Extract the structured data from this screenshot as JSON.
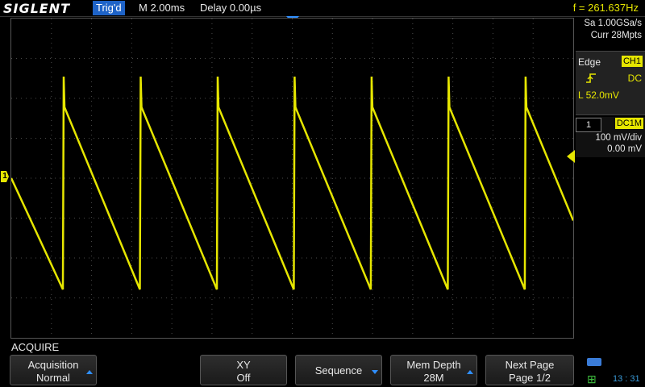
{
  "header": {
    "brand": "SIGLENT",
    "trigger_status": "Trig'd",
    "timebase": "M 2.00ms",
    "delay": "Delay 0.00µs",
    "frequency": "f = 261.637Hz"
  },
  "acquisition_info": {
    "sample_rate": "Sa 1.00GSa/s",
    "memory": "Curr 28Mpts"
  },
  "trigger_panel": {
    "type": "Edge",
    "source": "CH1",
    "slope_icon": "rising-edge-icon",
    "coupling": "DC",
    "level": "L  52.0mV"
  },
  "channel_panel": {
    "channel": "1",
    "coupling": "DC1M",
    "volts_per_div": "100 mV/div",
    "offset": "0.00 mV"
  },
  "channel_marker": "1",
  "waveform": {
    "type": "sawtooth",
    "color": "#e6e600",
    "periods_visible": 7.3
  },
  "menu": {
    "title": "ACQUIRE",
    "softkeys": [
      {
        "line1": "Acquisition",
        "line2": "Normal"
      },
      {
        "line1": "XY",
        "line2": "Off"
      },
      {
        "line1": "Sequence",
        "line2": ""
      },
      {
        "line1": "Mem Depth",
        "line2": "28M"
      },
      {
        "line1": "Next Page",
        "line2": "Page 1/2"
      }
    ]
  },
  "status": {
    "time": "13 : 31"
  },
  "colors": {
    "trace": "#e6e600",
    "accent": "#1e63c7",
    "grid": "#4a4a4a"
  }
}
